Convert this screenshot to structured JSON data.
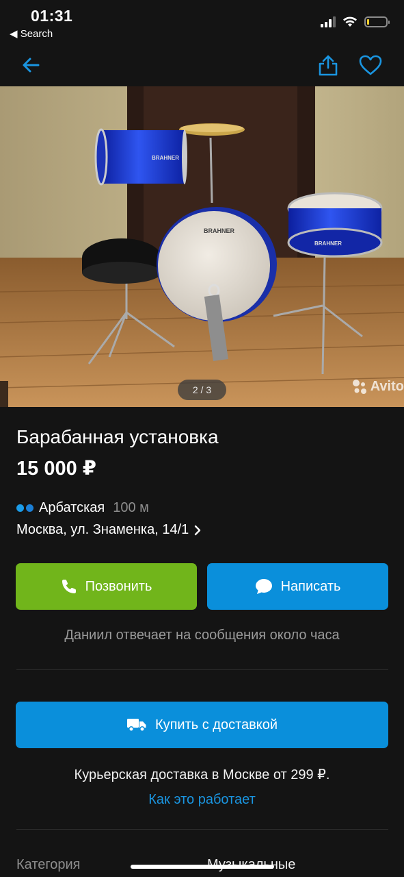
{
  "status_bar": {
    "time": "01:31",
    "back_label": "◀ Search"
  },
  "nav": {
    "back_icon": "arrow-left-icon",
    "share_icon": "share-icon",
    "favorite_icon": "heart-icon"
  },
  "photo": {
    "counter": "2 / 3",
    "watermark": "Avito",
    "drum_brand": "BRAHNER"
  },
  "listing": {
    "title": "Барабанная установка",
    "price": "15 000 ₽"
  },
  "location": {
    "metro_station": "Арбатская",
    "metro_distance": "100 м",
    "address": "Москва, ул. Знаменка, 14/1"
  },
  "actions": {
    "call_label": "Позвонить",
    "write_label": "Написать",
    "response_note": "Даниил отвечает на сообщения около часа",
    "buy_label": "Купить с доставкой",
    "delivery_note": "Курьерская доставка в Москве от 299 ₽.",
    "how_it_works": "Как это работает"
  },
  "params": {
    "category_label": "Категория",
    "category_value": "Музыкальные"
  },
  "colors": {
    "background": "#141414",
    "call_green": "#71b51b",
    "accent_blue": "#0a8fdb",
    "link_blue": "#1a95e0",
    "metro_dot_1": "#1b9ce8",
    "metro_dot_2": "#1b7fd6",
    "battery_yellow": "#f7d130"
  }
}
